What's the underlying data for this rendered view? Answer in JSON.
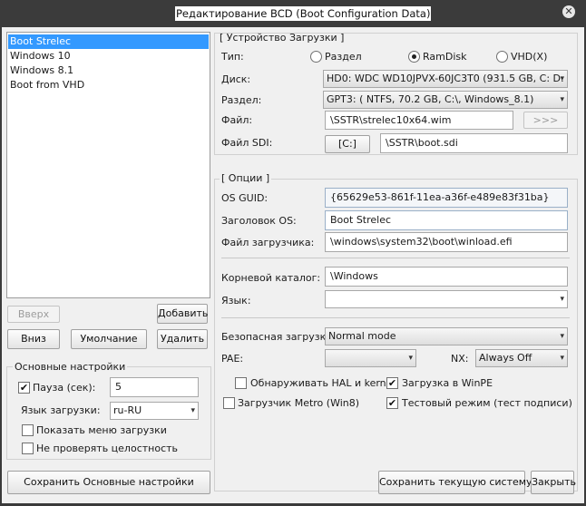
{
  "window": {
    "title": "Редактирование BCD (Boot Configuration Data)",
    "close": "✕"
  },
  "entries": [
    "Boot Strelec",
    "Windows 10",
    "Windows 8.1",
    "Boot from VHD"
  ],
  "left_buttons": {
    "up": "Вверх",
    "add": "Добавить",
    "down": "Вниз",
    "default": "Умолчание",
    "delete": "Удалить"
  },
  "basic_settings": {
    "title": "Основные настройки",
    "pause_label": "Пауза (сек):",
    "pause_checked": true,
    "pause_value": "5",
    "lang_label": "Язык загрузки:",
    "lang_value": "ru-RU",
    "show_menu_label": "Показать меню загрузки",
    "show_menu_checked": false,
    "no_integrity_label": "Не проверять целостность",
    "no_integrity_checked": false
  },
  "device": {
    "title": "[ Устройство Загрузки ]",
    "type_label": "Тип:",
    "type_options": [
      "Раздел",
      "RamDisk",
      "VHD(X)"
    ],
    "type_selected": "RamDisk",
    "disk_label": "Диск:",
    "disk_value": "HD0: WDC WD10JPVX-60JC3T0 (931.5 GB, C: D: G",
    "partition_label": "Раздел:",
    "partition_value": "GPT3: ( NTFS,  70.2 GB, C:\\, Windows_8.1)",
    "file_label": "Файл:",
    "file_value": "\\SSTR\\strelec10x64.wim",
    "browse": ">>>",
    "sdi_label": "Файл SDI:",
    "sdi_drive": "[C:]",
    "sdi_value": "\\SSTR\\boot.sdi"
  },
  "options": {
    "title": "[ Опции ]",
    "guid_label": "OS GUID:",
    "guid_value": "{65629e53-861f-11ea-a36f-e489e83f31ba}",
    "header_label": "Заголовок OS:",
    "header_value": "Boot Strelec",
    "loader_label": "Файл загрузчика:",
    "loader_value": "\\windows\\system32\\boot\\winload.efi",
    "root_label": "Корневой каталог:",
    "root_value": "\\Windows",
    "lang_label": "Язык:",
    "lang_value": "",
    "safeboot_label": "Безопасная загрузка:",
    "safeboot_value": "Normal mode",
    "pae_label": "PAE:",
    "pae_value": "",
    "nx_label": "NX:",
    "nx_value": "Always Off",
    "hal_label": "Обнаруживать HAL и kernel",
    "hal_checked": false,
    "winpe_label": "Загрузка в WinPE",
    "winpe_checked": true,
    "metro_label": "Загрузчик Metro (Win8)",
    "metro_checked": false,
    "testmode_label": "Тестовый режим (тест подписи)",
    "testmode_checked": true
  },
  "bottom": {
    "save_basic": "Сохранить Основные настройки",
    "save_current": "Сохранить текущую систему",
    "close": "Закрыть"
  },
  "icons": {
    "dropdown": "▾",
    "check": "✔"
  }
}
